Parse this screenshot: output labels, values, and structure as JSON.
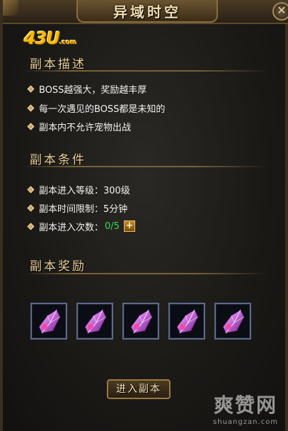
{
  "window": {
    "title": "异域时空",
    "close_symbol": "✕"
  },
  "logo": {
    "text": "43U",
    "suffix": ".com"
  },
  "description": {
    "heading": "副本描述",
    "items": [
      "BOSS越强大，奖励越丰厚",
      "每一次遇见的BOSS都是未知的",
      "副本内不允许宠物出战"
    ]
  },
  "conditions": {
    "heading": "副本条件",
    "level_label": "副本进入等级：",
    "level_value": "300级",
    "time_label": "副本时间限制：",
    "time_value": "5分钟",
    "count_label": "副本进入次数：",
    "count_value": "0/5",
    "add_symbol": "+"
  },
  "rewards": {
    "heading": "副本奖励",
    "items": [
      {
        "icon": "crystal-shard-icon"
      },
      {
        "icon": "crystal-shard-icon"
      },
      {
        "icon": "crystal-shard-icon"
      },
      {
        "icon": "crystal-shard-icon"
      },
      {
        "icon": "crystal-shard-icon"
      }
    ]
  },
  "actions": {
    "enter_label": "进入副本"
  },
  "watermark": {
    "main": "爽赞网",
    "sub": "shuangzan.com"
  },
  "colors": {
    "title": "#f3dfb0",
    "heading": "#e8cf9a",
    "body_text": "#f2f2f2",
    "count_value": "#35e04a",
    "slot_border": "#5c6a8a"
  }
}
